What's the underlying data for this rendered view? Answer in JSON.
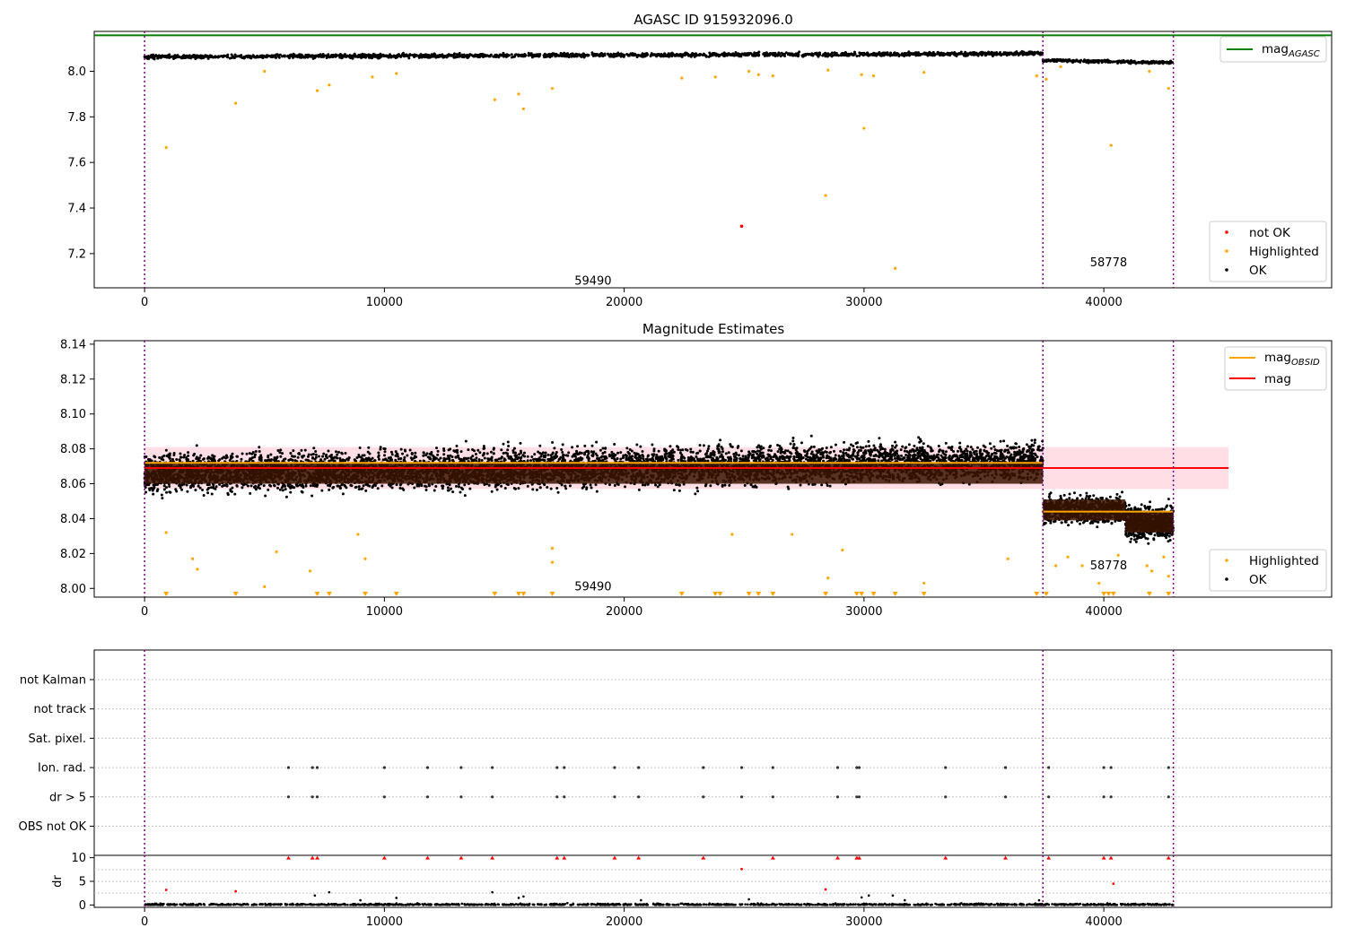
{
  "chart_data": [
    {
      "type": "scatter",
      "title": "AGASC ID 915932096.0",
      "xlim": [
        -2100,
        49500
      ],
      "ylim": [
        7.05,
        8.175
      ],
      "xticks": [
        0,
        10000,
        20000,
        30000,
        40000
      ],
      "yticks": [
        7.2,
        7.4,
        7.6,
        7.8,
        8.0
      ],
      "mag_agasc": 8.158,
      "obs_boundaries": [
        0,
        37460,
        42900
      ],
      "obs_labels": [
        {
          "text": "59490",
          "x": 18700,
          "y": 7.08
        },
        {
          "text": "58778",
          "x": 40200,
          "y": 7.16
        }
      ],
      "segments": [
        {
          "x0": 0,
          "x1": 37460,
          "y0": 8.063,
          "y1": 8.078,
          "spread": 0.008
        },
        {
          "x0": 37460,
          "x1": 42900,
          "y0": 8.048,
          "y1": 8.038,
          "spread": 0.006
        }
      ],
      "highlighted_points": [
        [
          900,
          7.665
        ],
        [
          3800,
          7.86
        ],
        [
          5000,
          8.0
        ],
        [
          7200,
          7.915
        ],
        [
          7700,
          7.94
        ],
        [
          9500,
          7.975
        ],
        [
          10500,
          7.99
        ],
        [
          14600,
          7.875
        ],
        [
          15600,
          7.9
        ],
        [
          15800,
          7.835
        ],
        [
          17000,
          7.925
        ],
        [
          22400,
          7.97
        ],
        [
          23800,
          7.975
        ],
        [
          25200,
          8.0
        ],
        [
          25600,
          7.985
        ],
        [
          26200,
          7.98
        ],
        [
          28400,
          7.455
        ],
        [
          28500,
          8.005
        ],
        [
          29900,
          7.985
        ],
        [
          30000,
          7.75
        ],
        [
          30400,
          7.98
        ],
        [
          31300,
          7.135
        ],
        [
          32500,
          7.995
        ],
        [
          37200,
          7.98
        ],
        [
          37600,
          7.965
        ],
        [
          38200,
          8.02
        ],
        [
          40300,
          7.675
        ],
        [
          41900,
          8.0
        ],
        [
          42700,
          7.925
        ]
      ],
      "not_ok_points": [
        [
          24900,
          7.32
        ]
      ],
      "legend": {
        "placement": "lower-right",
        "entries": [
          "not OK",
          "Highlighted",
          "OK"
        ]
      },
      "top_legend": {
        "placement": "upper-right",
        "label": "mag",
        "subscript": "AGASC"
      },
      "colors": {
        "ok": "#000000",
        "highlighted": "#ffa500",
        "not_ok": "#ff0000",
        "mag_agasc": "#008000",
        "boundary": "#800080"
      }
    },
    {
      "type": "scatter",
      "title": "Magnitude Estimates",
      "xlim": [
        -2100,
        49500
      ],
      "ylim": [
        7.995,
        8.142
      ],
      "xticks": [
        0,
        10000,
        20000,
        30000,
        40000
      ],
      "yticks": [
        8.0,
        8.02,
        8.04,
        8.06,
        8.08,
        8.1,
        8.12,
        8.14
      ],
      "mag": 8.069,
      "mag_band": [
        8.057,
        8.081
      ],
      "mag_band_xlim": [
        0,
        45200
      ],
      "mag_obsid": [
        {
          "x0": 0,
          "x1": 37460,
          "value": 8.072
        },
        {
          "x0": 37460,
          "x1": 42900,
          "value": 8.044
        }
      ],
      "obs_boundaries": [
        0,
        37460,
        42900
      ],
      "obs_labels": [
        {
          "text": "59490",
          "x": 18700,
          "y": 8.001
        },
        {
          "text": "58778",
          "x": 40200,
          "y": 8.013
        }
      ],
      "segments": [
        {
          "x0": 0,
          "x1": 37460,
          "y0": 8.066,
          "y1": 8.073,
          "spread": 0.018
        },
        {
          "x0": 37460,
          "x1": 40900,
          "y0": 8.045,
          "y1": 8.045,
          "spread": 0.012
        },
        {
          "x0": 40900,
          "x1": 42900,
          "y0": 8.038,
          "y1": 8.038,
          "spread": 0.015
        }
      ],
      "highlighted_points": [
        [
          900,
          8.032
        ],
        [
          2000,
          8.017
        ],
        [
          2200,
          8.011
        ],
        [
          5000,
          8.001
        ],
        [
          5500,
          8.021
        ],
        [
          6900,
          8.01
        ],
        [
          8900,
          8.031
        ],
        [
          9200,
          8.017
        ],
        [
          17000,
          8.023
        ],
        [
          17000,
          8.015
        ],
        [
          24500,
          8.031
        ],
        [
          27000,
          8.031
        ],
        [
          28500,
          8.006
        ],
        [
          29100,
          8.022
        ],
        [
          32500,
          8.003
        ],
        [
          36000,
          8.017
        ],
        [
          38000,
          8.013
        ],
        [
          38500,
          8.018
        ],
        [
          39100,
          8.013
        ],
        [
          39800,
          8.003
        ],
        [
          40600,
          8.019
        ],
        [
          41800,
          8.013
        ],
        [
          42000,
          8.01
        ],
        [
          42500,
          8.018
        ],
        [
          42700,
          8.007
        ]
      ],
      "clipped_points": [
        900,
        3800,
        7200,
        7700,
        9200,
        10500,
        14600,
        15600,
        15800,
        17000,
        22400,
        23800,
        24000,
        25200,
        25600,
        26200,
        28400,
        29700,
        29900,
        30400,
        31300,
        32500,
        37200,
        37600,
        40000,
        40200,
        40400,
        41900,
        42700
      ],
      "legend": {
        "placement": "lower-right",
        "entries": [
          "Highlighted",
          "OK"
        ]
      },
      "top_legend": {
        "placement": "upper-right",
        "entries": [
          {
            "label": "mag",
            "subscript": "OBSID",
            "color": "#ffa500"
          },
          {
            "label": "mag",
            "subscript": "",
            "color": "#ff0000"
          }
        ]
      },
      "colors": {
        "ok": "#000000",
        "highlighted": "#ffa500",
        "mag": "#ff0000",
        "mag_obsid": "#ffa500",
        "band": "#ffc0cb",
        "core": "#3b1400"
      }
    },
    {
      "type": "scatter",
      "title": "",
      "xlim": [
        -2100,
        49500
      ],
      "categories": [
        "not Kalman",
        "not track",
        "Sat. pixel.",
        "Ion. rad.",
        "dr > 5",
        "OBS not OK"
      ],
      "flag_x": [
        6000,
        7000,
        7200,
        10000,
        11800,
        13200,
        14500,
        17200,
        17500,
        19600,
        20600,
        23300,
        24900,
        26200,
        28900,
        29700,
        29800,
        33400,
        35900,
        37700,
        40000,
        40300,
        42700
      ],
      "flagged_in": [
        "Ion. rad.",
        "dr > 5"
      ],
      "obs_boundaries": [
        0,
        37460,
        42900
      ]
    },
    {
      "type": "scatter",
      "title": "",
      "ylabel": "dr",
      "xlim": [
        -2100,
        49500
      ],
      "ylim": [
        -0.5,
        10.5
      ],
      "yticks": [
        0,
        5,
        10
      ],
      "xticks": [
        0,
        10000,
        20000,
        30000,
        40000
      ],
      "clipped_dr_x": [
        6000,
        7000,
        7200,
        10000,
        11800,
        13200,
        14500,
        17200,
        17500,
        19600,
        20600,
        23300,
        26200,
        28900,
        29700,
        29800,
        33400,
        35900,
        37700,
        40000,
        40300,
        42700
      ],
      "red_points": [
        [
          900,
          3.2
        ],
        [
          3800,
          2.9
        ],
        [
          24900,
          7.6
        ],
        [
          28400,
          3.3
        ],
        [
          40400,
          4.5
        ]
      ],
      "black_points": [
        [
          7100,
          2.0
        ],
        [
          7700,
          2.7
        ],
        [
          9000,
          1.0
        ],
        [
          10500,
          1.5
        ],
        [
          14500,
          2.7
        ],
        [
          15600,
          1.5
        ],
        [
          15800,
          1.8
        ],
        [
          20700,
          1.0
        ],
        [
          25200,
          1.2
        ],
        [
          29900,
          1.6
        ],
        [
          30200,
          2.0
        ],
        [
          31200,
          2.0
        ],
        [
          31700,
          1.0
        ],
        [
          37300,
          1.0
        ]
      ],
      "obs_boundaries": [
        0,
        37460,
        42900
      ]
    }
  ]
}
